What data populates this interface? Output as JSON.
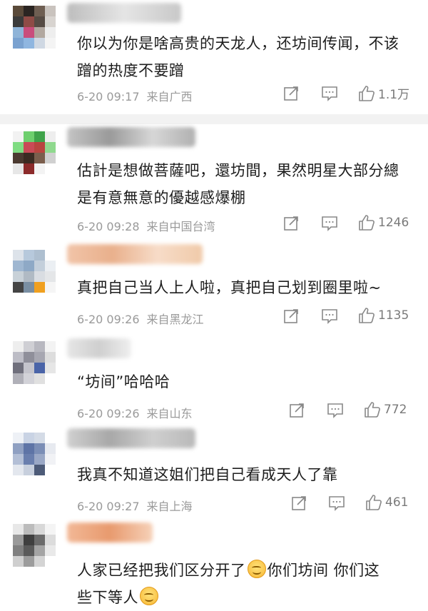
{
  "comments": [
    {
      "text": "你以为你是啥高贵的天龙人，还坊间传闻，不该蹭的热度不要蹭",
      "date": "6-20 09:17",
      "location": "来自广西",
      "likes": "1.1万"
    },
    {
      "text": "估計是想做菩薩吧，還坊間，果然明星大部分總是有意無意的優越感爆棚",
      "date": "6-20 09:28",
      "location": "来自中国台湾",
      "likes": "1246"
    },
    {
      "text": "真把自己当人上人啦，真把自己划到圈里啦~",
      "date": "6-20 09:26",
      "location": "来自黑龙江",
      "likes": "1135"
    },
    {
      "text": "“坊间”哈哈哈",
      "date": "6-20 09:26",
      "location": "来自山东",
      "likes": "772"
    },
    {
      "text": "我真不知道这姐们把自己看成天人了靠",
      "date": "6-20 09:27",
      "location": "来自上海",
      "likes": "461"
    },
    {
      "text_part1": "人家已经把我们区分开了",
      "text_part2": "你们坊间 你们这",
      "text_part3": "些下等人"
    }
  ],
  "icons": [
    "share-icon",
    "comment-icon",
    "like-icon",
    "smile-emoji"
  ],
  "colors": {
    "meta": "#9a9a9a",
    "text": "#1d1d1d",
    "separator": "#f2f2f2"
  }
}
